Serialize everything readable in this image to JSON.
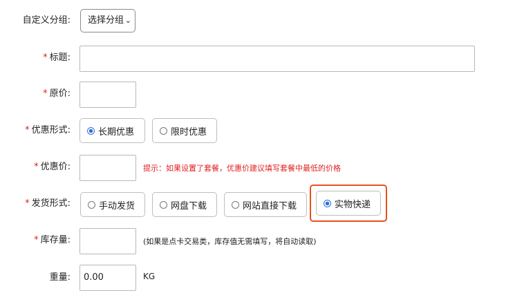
{
  "fields": {
    "group": {
      "label": "自定义分组:",
      "select_value": "选择分组",
      "icon": "chevron-down-icon"
    },
    "title": {
      "required_mark": "*",
      "label": "标题:"
    },
    "price": {
      "required_mark": "*",
      "label": "原价:"
    },
    "discount_type": {
      "required_mark": "*",
      "label": "优惠形式:",
      "options": [
        "长期优惠",
        "限时优惠"
      ],
      "selected": "长期优惠"
    },
    "discount_price": {
      "required_mark": "*",
      "label": "优惠价:",
      "hint": "提示：如果设置了套餐，优惠价建议填写套餐中最低的价格",
      "hint_color": "#e02020"
    },
    "delivery": {
      "required_mark": "*",
      "label": "发货形式:",
      "options": [
        "手动发货",
        "网盘下载",
        "网站直接下载",
        "实物快递"
      ],
      "selected": "实物快递"
    },
    "stock": {
      "required_mark": "*",
      "label": "库存量:",
      "hint": "(如果是点卡交易类，库存值无需填写，将自动读取)"
    },
    "weight": {
      "label": "重量:",
      "value": "0.00",
      "unit": "KG"
    }
  },
  "colors": {
    "required": "#e02020",
    "highlight": "#e8501c",
    "radio_selected": "#2b72d8"
  }
}
